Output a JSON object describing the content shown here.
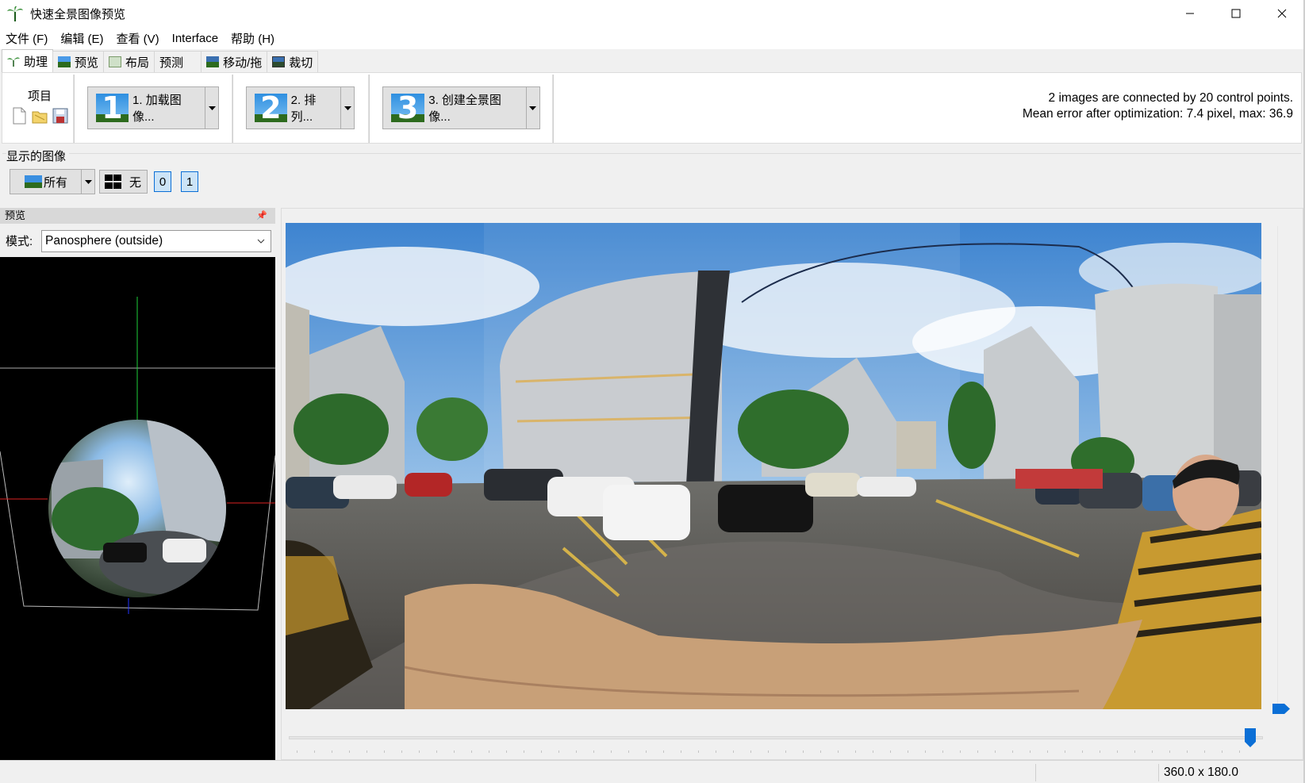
{
  "window": {
    "title": "快速全景图像预览",
    "icon": "hugin-app-icon"
  },
  "menu": [
    {
      "label": "文件 (F)"
    },
    {
      "label": "编辑 (E)"
    },
    {
      "label": "查看 (V)"
    },
    {
      "label": "Interface"
    },
    {
      "label": "帮助 (H)"
    }
  ],
  "tabs": [
    {
      "label": "助理",
      "icon": "assistant-icon",
      "active": true
    },
    {
      "label": "预览",
      "icon": "preview-icon"
    },
    {
      "label": "布局",
      "icon": "layout-icon"
    },
    {
      "label": "预测"
    },
    {
      "label": "移动/拖",
      "icon": "move-drag-icon"
    },
    {
      "label": "裁切",
      "icon": "crop-icon"
    }
  ],
  "project": {
    "label": "项目",
    "icons": [
      "new-file-icon",
      "open-folder-icon",
      "save-icon"
    ]
  },
  "steps": [
    {
      "number": "1",
      "label": "1. 加载图像..."
    },
    {
      "number": "2",
      "label": "2. 排列..."
    },
    {
      "number": "3",
      "label": "3. 创建全景图像..."
    }
  ],
  "status": {
    "line1": "2 images are connected by 20 control points.",
    "line2": "Mean error after optimization: 7.4 pixel, max: 36.9"
  },
  "display_images": {
    "label": "显示的图像",
    "all_label": "所有",
    "none_label": "无",
    "image_buttons": [
      "0",
      "1"
    ]
  },
  "preview_panel": {
    "title": "预览",
    "mode_label": "模式:",
    "mode_value": "Panosphere (outside)"
  },
  "statusbar": {
    "fov": "360.0 x 180.0"
  },
  "colors": {
    "selected_button": "#cce4f7",
    "selected_border": "#0b6fd6",
    "accent": "#0b6fd6"
  }
}
